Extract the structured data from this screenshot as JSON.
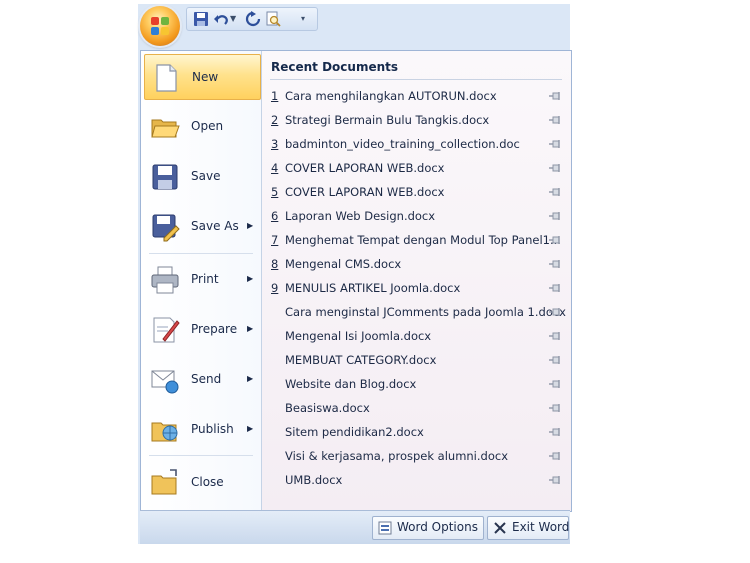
{
  "menu": {
    "commands": [
      {
        "label": "New",
        "icon": "new-document-icon",
        "submenu": false,
        "active": true
      },
      {
        "label": "Open",
        "icon": "open-folder-icon",
        "submenu": false
      },
      {
        "label": "Save",
        "icon": "save-floppy-icon",
        "submenu": false
      },
      {
        "label": "Save As",
        "icon": "save-as-icon",
        "submenu": true
      },
      {
        "label": "Print",
        "icon": "printer-icon",
        "submenu": true
      },
      {
        "label": "Prepare",
        "icon": "prepare-document-icon",
        "submenu": true
      },
      {
        "label": "Send",
        "icon": "send-icon",
        "submenu": true
      },
      {
        "label": "Publish",
        "icon": "publish-icon",
        "submenu": true
      },
      {
        "label": "Close",
        "icon": "close-folder-icon",
        "submenu": false
      }
    ]
  },
  "recent": {
    "title": "Recent Documents",
    "items": [
      {
        "num": "1",
        "name": "Cara menghilangkan AUTORUN.docx"
      },
      {
        "num": "2",
        "name": "Strategi Bermain Bulu Tangkis.docx"
      },
      {
        "num": "3",
        "name": "badminton_video_training_collection.doc"
      },
      {
        "num": "4",
        "name": "COVER LAPORAN WEB.docx"
      },
      {
        "num": "5",
        "name": "COVER LAPORAN WEB.docx"
      },
      {
        "num": "6",
        "name": "Laporan Web Design.docx"
      },
      {
        "num": "7",
        "name": "Menghemat Tempat dengan Modul Top Panel1..."
      },
      {
        "num": "8",
        "name": "Mengenal CMS.docx"
      },
      {
        "num": "9",
        "name": "MENULIS ARTIKEL Joomla.docx"
      },
      {
        "num": "",
        "name": "Cara menginstal JComments pada Joomla 1.docx"
      },
      {
        "num": "",
        "name": "Mengenal Isi Joomla.docx"
      },
      {
        "num": "",
        "name": "MEMBUAT CATEGORY.docx"
      },
      {
        "num": "",
        "name": "Website dan Blog.docx"
      },
      {
        "num": "",
        "name": "Beasiswa.docx"
      },
      {
        "num": "",
        "name": "Sitem pendidikan2.docx"
      },
      {
        "num": "",
        "name": "Visi & kerjasama, prospek alumni.docx"
      },
      {
        "num": "",
        "name": "UMB.docx"
      }
    ]
  },
  "footer": {
    "word_options": "Word Options",
    "exit_word": "Exit Word"
  },
  "colors": {
    "accent": "#ffd15e",
    "frame": "#dbe7f6",
    "text": "#1b2a4a"
  }
}
